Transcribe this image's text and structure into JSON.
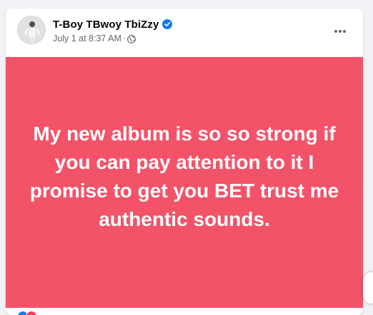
{
  "post": {
    "author": "T-Boy TBwoy TbiZzy",
    "timestamp": "July 1 at 8:37 AM",
    "separator": "·",
    "audience_icon": "globe-icon",
    "verified_icon": "verified-badge-icon",
    "more_icon": "ellipsis-icon",
    "text": "My new album is so so strong if you can pay attention to it I promise to get you BET trust me authentic sounds.",
    "background_color": "#f35369"
  },
  "colors": {
    "verified": "#1877f2",
    "meta_text": "#65676b"
  }
}
